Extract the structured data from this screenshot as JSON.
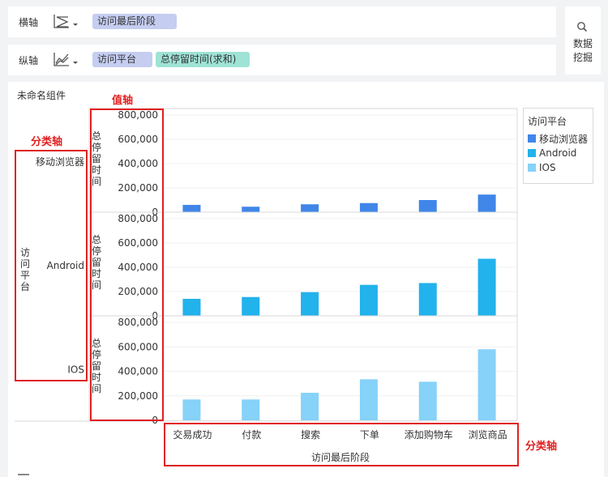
{
  "toolbar": {
    "x_row": {
      "label": "横轴",
      "chart_type_icon": "zigzag-chart-icon",
      "fields": [
        "访问最后阶段"
      ]
    },
    "y_row": {
      "label": "纵轴",
      "chart_type_icon": "line-chart-icon",
      "fields": [
        "访问平台",
        "总停留时间(求和)"
      ]
    },
    "data_mining": {
      "icon": "search-icon",
      "line1": "数据",
      "line2": "挖掘"
    }
  },
  "component": {
    "title": "未命名组件"
  },
  "annotations": {
    "value_axis": "值轴",
    "category_axis_left": "分类轴",
    "category_axis_bottom": "分类轴"
  },
  "colors": {
    "移动浏览器": "#3f86e8",
    "Android": "#22b2ec",
    "IOS": "#86d2f8",
    "annotation": "#e02020"
  },
  "chart_data": {
    "type": "bar",
    "layout": "facet rows by 访问平台",
    "categories": [
      "交易成功",
      "付款",
      "搜索",
      "下单",
      "添加购物车",
      "浏览商品"
    ],
    "xlabel": "访问最后阶段",
    "row_axis_label": "访问平台",
    "ylabel": "总停留时间",
    "ylim": [
      0,
      800000
    ],
    "yticks": [
      "800,000",
      "600,000",
      "400,000",
      "200,000",
      "0"
    ],
    "legend": {
      "title": "访问平台",
      "entries": [
        "移动浏览器",
        "Android",
        "IOS"
      ],
      "position": "top-right"
    },
    "series": [
      {
        "name": "移动浏览器",
        "values": [
          60000,
          45000,
          65000,
          75000,
          100000,
          145000
        ]
      },
      {
        "name": "Android",
        "values": [
          140000,
          155000,
          195000,
          255000,
          270000,
          470000
        ]
      },
      {
        "name": "IOS",
        "values": [
          170000,
          170000,
          225000,
          335000,
          315000,
          580000
        ]
      }
    ]
  }
}
